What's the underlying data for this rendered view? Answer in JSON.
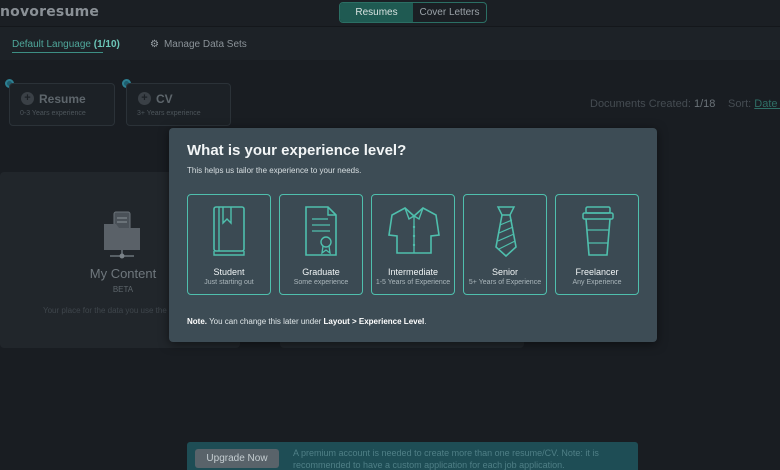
{
  "app": {
    "logo": "novoresume"
  },
  "top_tabs": [
    {
      "label": "Resumes",
      "active": true
    },
    {
      "label": "Cover Letters",
      "active": false
    }
  ],
  "subbar": {
    "language_label": "Default Language",
    "language_count": "(1/10)",
    "manage_label": "Manage Data Sets"
  },
  "doc_cards": [
    {
      "title": "Resume",
      "subtitle": "0-3 Years experience"
    },
    {
      "title": "CV",
      "subtitle": "3+ Years experience"
    }
  ],
  "documents_created": {
    "label": "Documents Created:",
    "value": "1/18"
  },
  "sort": {
    "label": "Sort:",
    "value": "Date A"
  },
  "my_content": {
    "title": "My Content",
    "badge": "BETA",
    "description": "Your place for the data you use the"
  },
  "modal": {
    "title": "What is your experience level?",
    "subtitle": "This helps us tailor the experience to your needs.",
    "levels": [
      {
        "name": "Student",
        "desc": "Just starting out",
        "icon": "book-icon"
      },
      {
        "name": "Graduate",
        "desc": "Some experience",
        "icon": "certificate-icon"
      },
      {
        "name": "Intermediate",
        "desc": "1-5 Years of Experience",
        "icon": "shirt-icon"
      },
      {
        "name": "Senior",
        "desc": "5+ Years of Experience",
        "icon": "tie-icon"
      },
      {
        "name": "Freelancer",
        "desc": "Any Experience",
        "icon": "coffee-cup-icon"
      }
    ],
    "note_prefix": "Note.",
    "note_text": "You can change this later under",
    "note_path": "Layout > Experience Level",
    "note_suffix": "."
  },
  "upgrade": {
    "button_label": "Upgrade Now",
    "message": "A premium account is needed to create more than one resume/CV. Note: it is recommended to have a custom application for each job application."
  },
  "colors": {
    "accent": "#4fbfad",
    "modal_bg": "#3d4c55",
    "page_bg": "#191d22"
  }
}
